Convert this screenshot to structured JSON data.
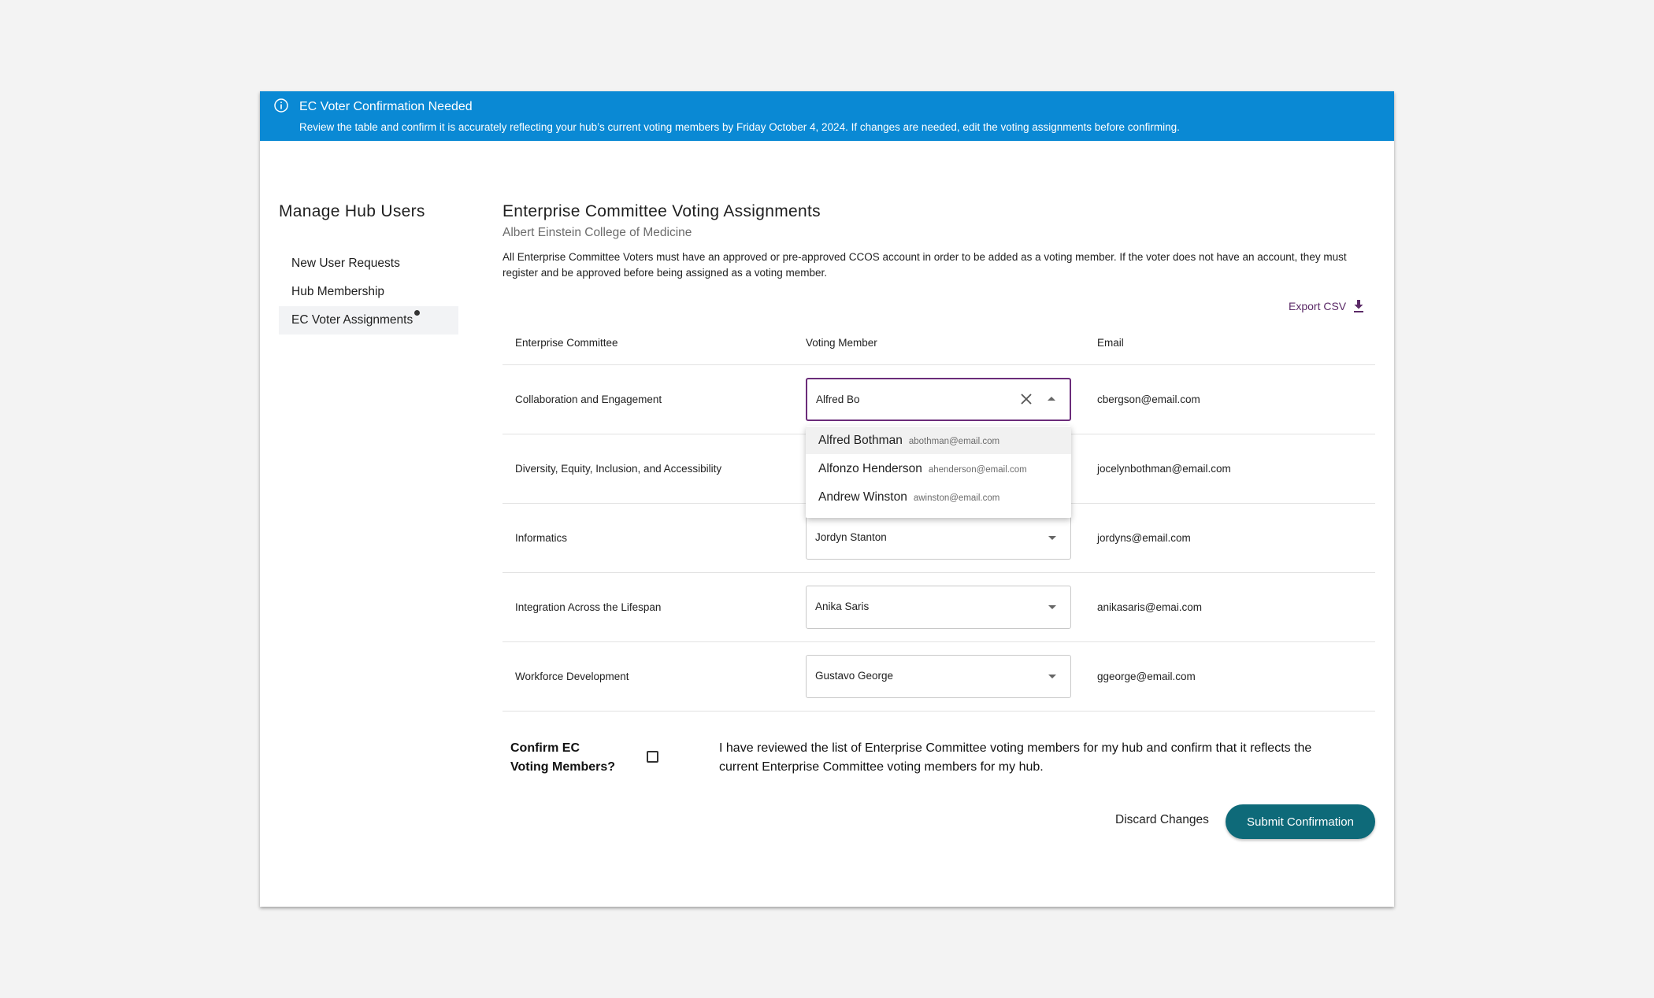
{
  "banner": {
    "icon": "info-icon",
    "title": "EC Voter Confirmation Needed",
    "text": "Review the table and confirm it is accurately reflecting your hub’s current voting members by Friday October 4, 2024. If changes are needed, edit the voting assignments before confirming."
  },
  "sidebar": {
    "title": "Manage Hub Users",
    "items": [
      {
        "label": "New User Requests"
      },
      {
        "label": "Hub Membership"
      },
      {
        "label": "EC Voter Assignments",
        "active": true
      }
    ]
  },
  "main": {
    "title": "Enterprise Committee Voting Assignments",
    "subtitle": "Albert Einstein College of Medicine",
    "description": "All Enterprise Committee Voters must have an approved or pre-approved CCOS account in order to be added as a voting member. If the voter does not have an account, they must register and be approved before being assigned as a voting member.",
    "export_label": "Export CSV"
  },
  "table": {
    "headers": [
      "Enterprise Committee",
      "Voting Member",
      "Email"
    ],
    "rows": [
      {
        "committee": "Collaboration and Engagement",
        "member": "Alfred Bo",
        "email": "cbergson@email.com"
      },
      {
        "committee": "Diversity, Equity, Inclusion, and Accessibility",
        "member": "",
        "email": "jocelynbothman@email.com"
      },
      {
        "committee": "Informatics",
        "member": "Jordyn Stanton",
        "email": "jordyns@email.com"
      },
      {
        "committee": "Integration Across the Lifespan",
        "member": "Anika Saris",
        "email": "anikasaris@emai.com"
      },
      {
        "committee": "Workforce Development",
        "member": "Gustavo George",
        "email": "ggeorge@email.com"
      }
    ]
  },
  "dropdown": {
    "options": [
      {
        "name": "Alfred Bothman",
        "email": "abothman@email.com"
      },
      {
        "name": "Alfonzo Henderson",
        "email": "ahenderson@email.com"
      },
      {
        "name": "Andrew Winston",
        "email": "awinston@email.com"
      }
    ]
  },
  "confirm": {
    "label_line1": "Confirm EC",
    "label_line2": "Voting Members?",
    "checked": false,
    "text": "I have reviewed the list of Enterprise Committee voting members for my hub and confirm that it reflects the current Enterprise Committee voting members for my hub."
  },
  "actions": {
    "discard_label": "Discard Changes",
    "submit_label": "Submit Confirmation"
  },
  "colors": {
    "banner": "#0a89d4",
    "accent": "#6b2c7a",
    "submit": "#0e6a79"
  }
}
